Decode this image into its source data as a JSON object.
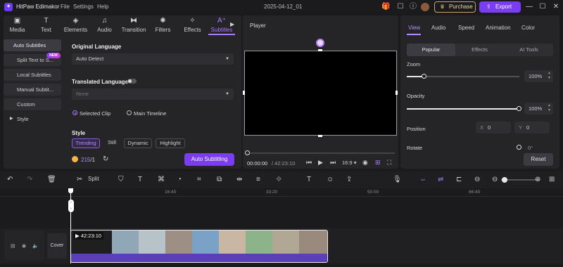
{
  "app": {
    "name": "HitPaw Edimakor",
    "project_title": "2025-04-12_01",
    "menu": [
      "File",
      "Settings",
      "Help"
    ]
  },
  "header": {
    "purchase_label": "Purchase",
    "export_label": "Export"
  },
  "media_tabs": [
    "Media",
    "Text",
    "Elements",
    "Audio",
    "Transition",
    "Filters",
    "Effects",
    "Subtitles"
  ],
  "sidebar": {
    "items": [
      "Auto Subtitles",
      "Split Text to S...",
      "Local Subtitles",
      "Manual Subtit...",
      "Custom",
      "Style"
    ],
    "new_badge": "NEW"
  },
  "subtitles": {
    "original_language_label": "Original Language",
    "original_language_value": "Auto Detect",
    "translated_language_label": "Translated Language",
    "translated_language_value": "None",
    "scope_options": [
      "Selected Clip",
      "Main Timeline"
    ],
    "style_label": "Style",
    "styles": [
      "Trending",
      "Still",
      "Dynamic",
      "Highlight"
    ],
    "credits_used": "215",
    "credits_total": "/1",
    "auto_button": "Auto Subtitling"
  },
  "player": {
    "label": "Player",
    "current_time": "00:00:00",
    "total_time": "/ 42:23:10",
    "aspect_ratio": "16:9"
  },
  "properties": {
    "tabs": [
      "View",
      "Audio",
      "Speed",
      "Animation",
      "Color"
    ],
    "subtabs": [
      "Popular",
      "Effects",
      "AI Tools"
    ],
    "zoom_label": "Zoom",
    "zoom_value": "100%",
    "zoom_level": 0.15,
    "opacity_label": "Opacity",
    "opacity_value": "100%",
    "opacity_level": 1.0,
    "position_label": "Position",
    "pos_x_label": "X",
    "pos_x": "0",
    "pos_y_label": "Y",
    "pos_y": "0",
    "rotate_label": "Rotate",
    "rotate_value": "0°",
    "reset_label": "Reset"
  },
  "timeline": {
    "split_label": "Split",
    "ruler_ticks": [
      "16:40",
      "33:20",
      "50:00",
      "66:40"
    ],
    "cover_label": "Cover",
    "clip_duration": "42:23:10",
    "colors": {
      "accent": "#7a3df2",
      "clip_bar": "#5b3fb8"
    }
  }
}
